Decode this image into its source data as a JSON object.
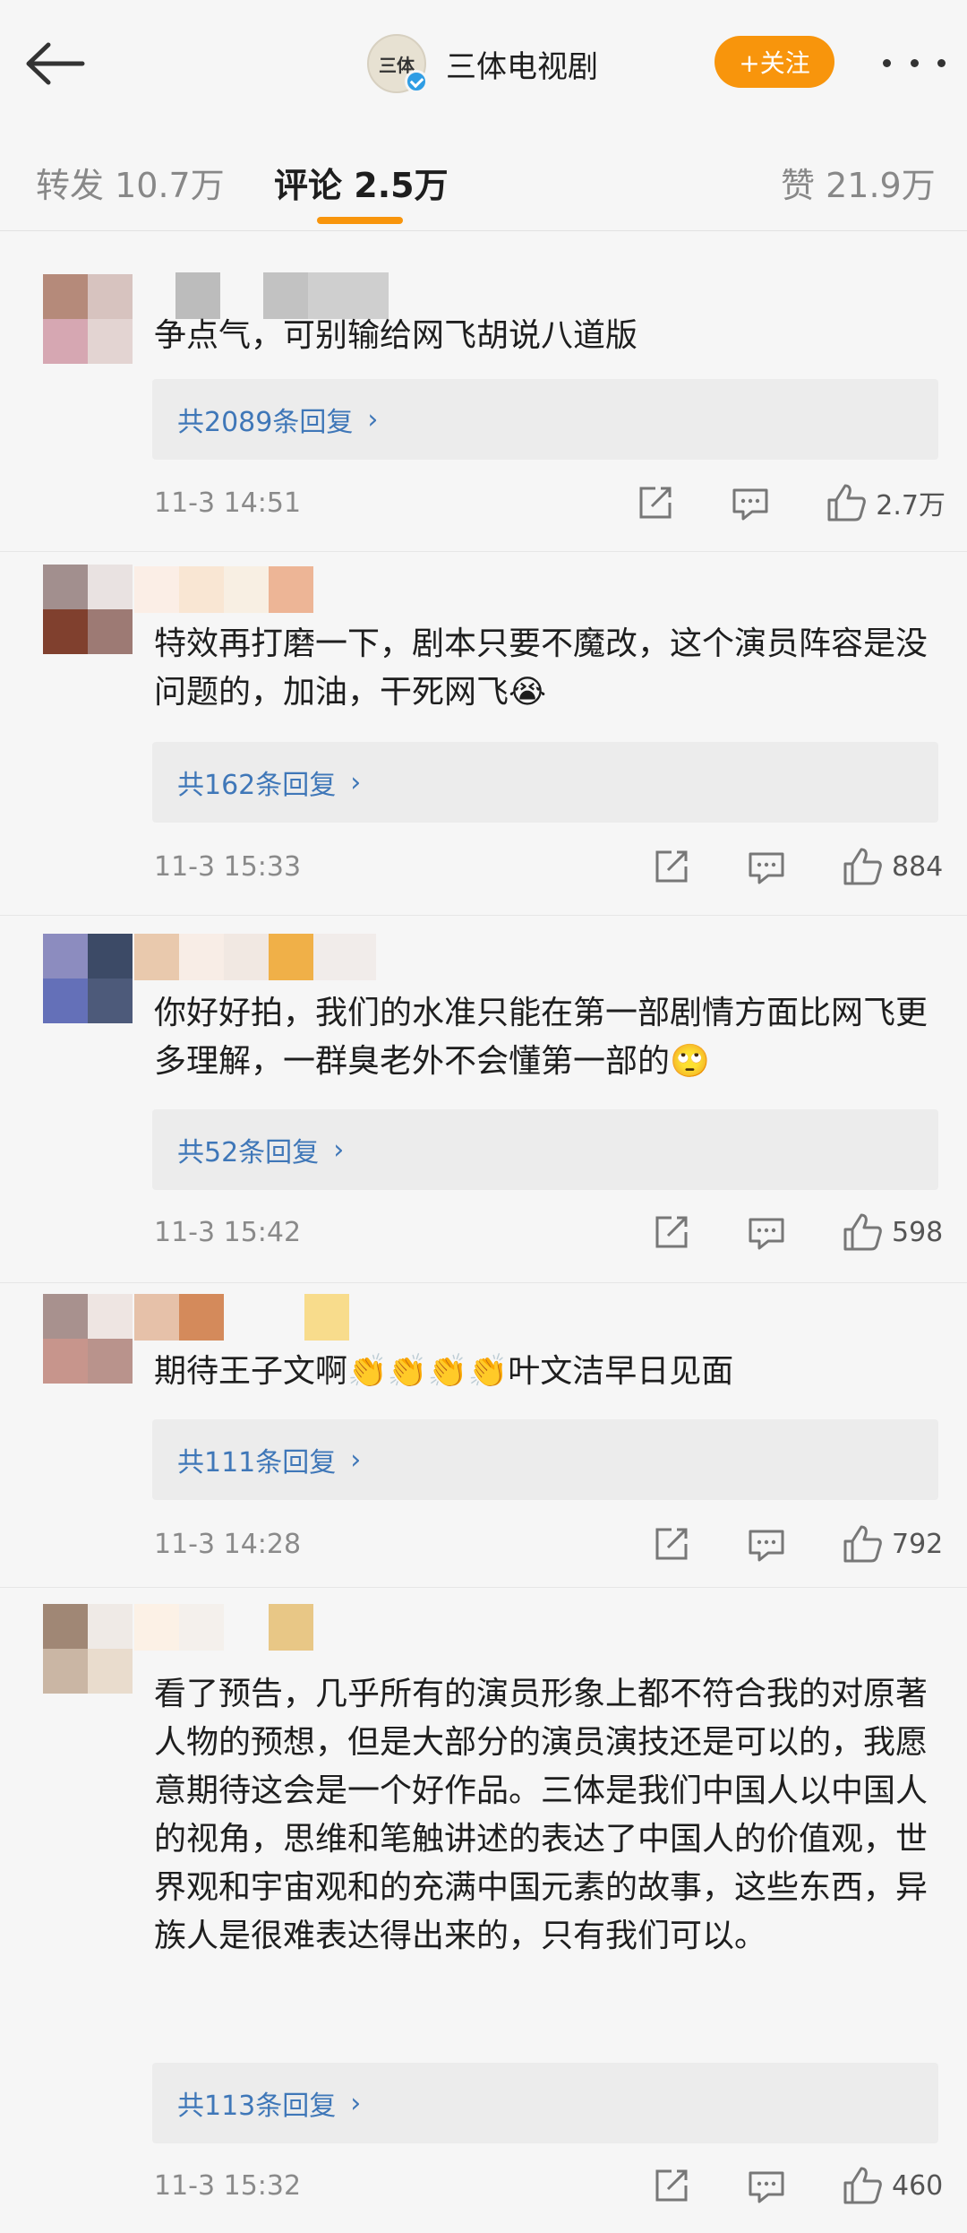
{
  "header": {
    "account_name": "三体电视剧",
    "avatar_text": "三体",
    "follow_label": "+关注"
  },
  "tabs": [
    {
      "label": "转发",
      "count": "10.7万"
    },
    {
      "label": "评论",
      "count": "2.5万"
    },
    {
      "label": "赞",
      "count": "21.9万"
    }
  ],
  "comments": [
    {
      "text": "争点气，可别输给网飞胡说八道版",
      "replies_label": "共2089条回复",
      "time": "11-3 14:51",
      "likes": "2.7万"
    },
    {
      "text": "特效再打磨一下，剧本只要不魔改，这个演员阵容是没问题的，加油，干死网飞😭",
      "replies_label": "共162条回复",
      "time": "11-3 15:33",
      "likes": "884"
    },
    {
      "text": "你好好拍，我们的水准只能在第一部剧情方面比网飞更多理解，一群臭老外不会懂第一部的🙄",
      "replies_label": "共52条回复",
      "time": "11-3 15:42",
      "likes": "598"
    },
    {
      "text": "期待王子文啊👏👏👏👏叶文洁早日见面",
      "replies_label": "共111条回复",
      "time": "11-3 14:28",
      "likes": "792"
    },
    {
      "text": "看了预告，几乎所有的演员形象上都不符合我的对原著人物的预想，但是大部分的演员演技还是可以的，我愿意期待这会是一个好作品。三体是我们中国人以中国人的视角，思维和笔触讲述的表达了中国人的价值观，世界观和宇宙观和的充满中国元素的故事，这些东西，异族人是很难表达得出来的，只有我们可以。",
      "replies_label": "共113条回复",
      "time": "11-3 15:32",
      "likes": "460"
    }
  ],
  "colors": {
    "accent": "#f8950c",
    "link": "#3f77b8",
    "background": "#f6f6f6"
  }
}
